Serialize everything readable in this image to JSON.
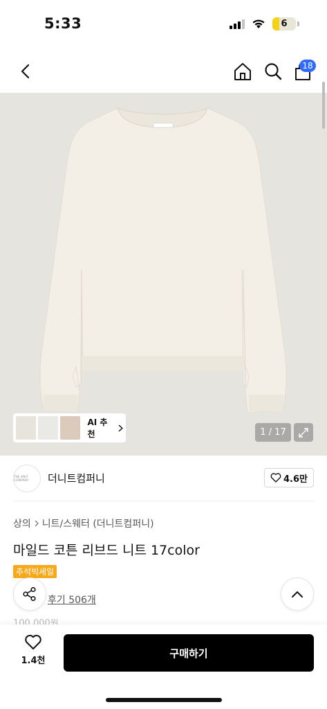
{
  "status_bar": {
    "time": "5:33",
    "battery_level": "6",
    "icons": [
      "cellular-signal-icon",
      "wifi-icon",
      "battery-icon"
    ]
  },
  "top_nav": {
    "icons": [
      "back-chevron-icon",
      "home-icon",
      "search-icon",
      "shopping-bag-icon"
    ],
    "cart_count": "18"
  },
  "product_image": {
    "thumbnails": [
      "thumbnail-cream-sweater",
      "thumbnail-white-sweater",
      "thumbnail-beige-sweater"
    ],
    "ai_recommend_label": "AI 추천",
    "pager": "1 / 17",
    "expand_icon": "expand-icon"
  },
  "brand": {
    "logo_text": "THE KNIT COMPANY",
    "name": "더니트컴퍼니",
    "like_count": "4.6만"
  },
  "breadcrumb": {
    "category": "상의",
    "subcategory": "니트/스웨터 (더니트컴퍼니)"
  },
  "product": {
    "title": "마일드 코튼 리브드 니트 17color",
    "sale_badge": "추석빅세일",
    "review_text": "후기 506개",
    "price_partial": "100,000원"
  },
  "bottom_bar": {
    "like_count": "1.4천",
    "buy_label": "구매하기"
  },
  "colors": {
    "accent_blue": "#2f6bff",
    "sale_orange": "#f8a91b",
    "image_bg": "#e6e4df",
    "sweater": "#f3efe6"
  }
}
